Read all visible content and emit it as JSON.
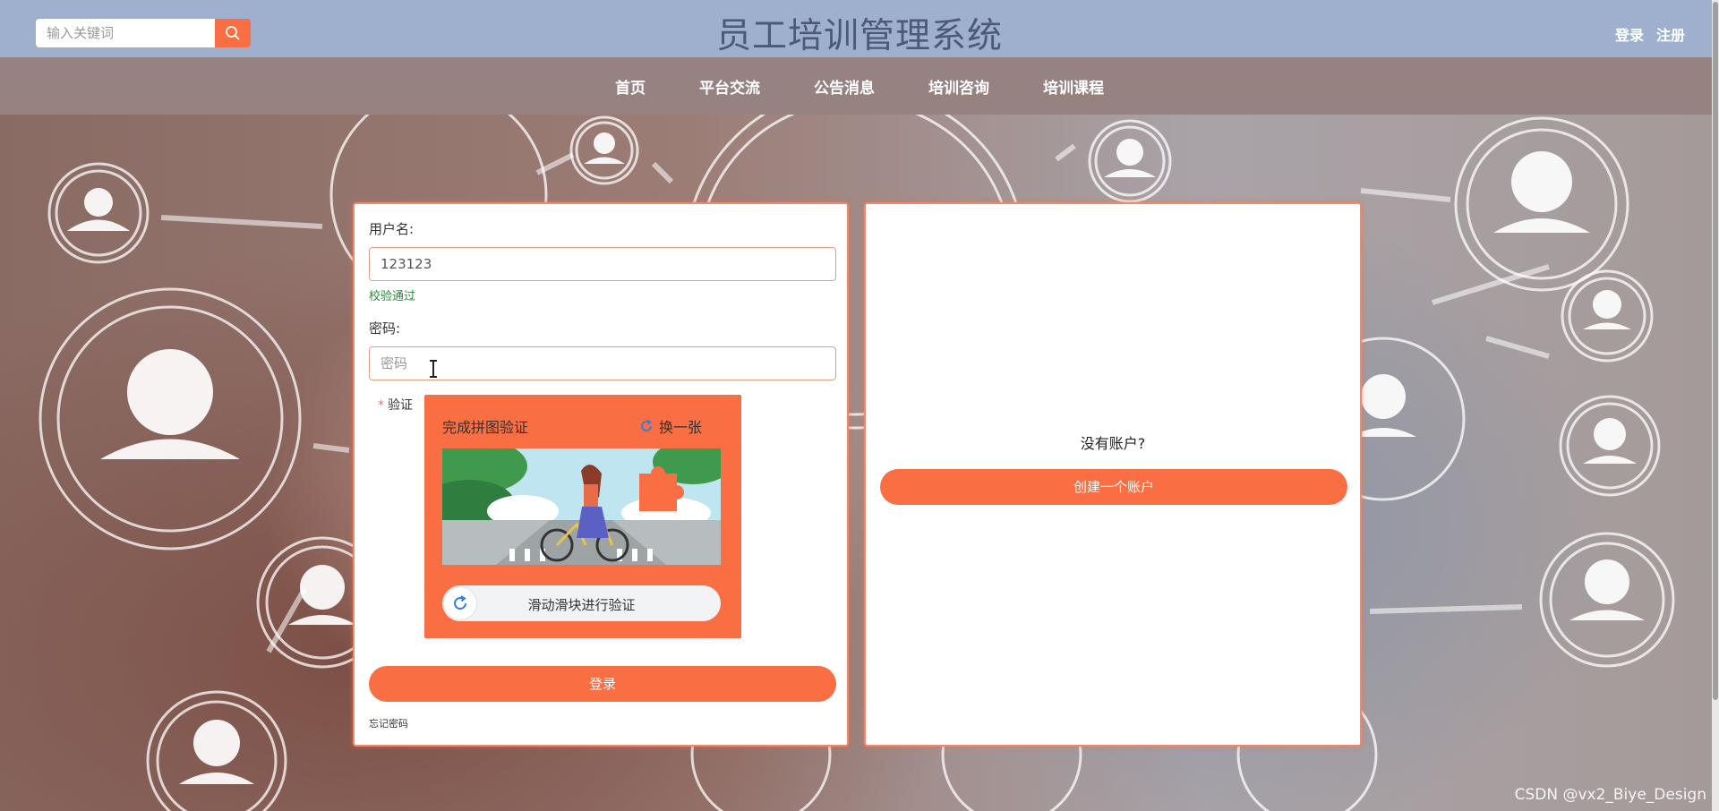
{
  "header": {
    "search_placeholder": "输入关键词",
    "search_icon": "search-icon",
    "title": "员工培训管理系统",
    "login_link": "登录",
    "register_link": "注册"
  },
  "nav": {
    "items": [
      "首页",
      "平台交流",
      "公告消息",
      "培训咨询",
      "培训课程"
    ]
  },
  "login_form": {
    "username_label": "用户名:",
    "username_value": "123123",
    "username_status": "校验通过",
    "password_label": "密码:",
    "password_placeholder": "密码",
    "captcha_label": "验证",
    "captcha_required_mark": "*",
    "captcha": {
      "title": "完成拼图验证",
      "refresh_label": "换一张",
      "slider_text": "滑动滑块进行验证"
    },
    "submit_label": "登录",
    "forgot_label": "忘记密码"
  },
  "register_panel": {
    "prompt": "没有账户?",
    "create_label": "创建一个账户"
  },
  "watermark": "CSDN @vx2_Biye_Design",
  "colors": {
    "accent": "#f96e43",
    "header_bg": "#9eb0cd",
    "nav_bg": "#968381",
    "title_color": "#4a5a77",
    "success": "#2a8a3a"
  }
}
